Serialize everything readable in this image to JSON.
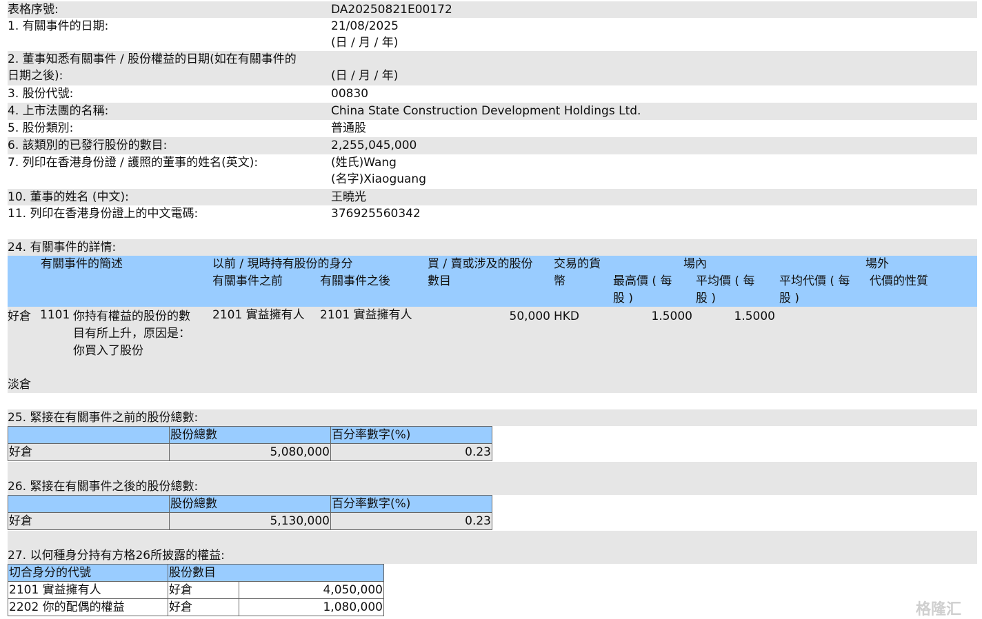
{
  "form": {
    "serial_label": "表格序號:",
    "serial": "DA20250821E00172",
    "f1_label": "1. 有關事件的日期:",
    "f1_value": "21/08/2025",
    "date_fmt": "(日 / 月 / 年)",
    "f2_label_l1": "2. 董事知悉有關事件 / 股份權益的日期(如在有關事件的",
    "f2_label_l2": "日期之後):",
    "f2_value": "(日 / 月 / 年)",
    "f3_label": "3. 股份代號:",
    "f3_value": "00830",
    "f4_label": "4. 上市法團的名稱:",
    "f4_value": "China State Construction Development Holdings Ltd.",
    "f5_label": "5. 股份類別:",
    "f5_value": "普通股",
    "f6_label": "6. 該類別的已發行股份的數目:",
    "f6_value": "2,255,045,000",
    "f7_label": "7. 列印在香港身份證 / 護照的董事的姓名(英文):",
    "f7_surname": "(姓氏)Wang",
    "f7_given": "(名字)Xiaoguang",
    "f10_label": "10. 董事的姓名 (中文):",
    "f10_value": "王曉光",
    "f11_label": "11. 列印在香港身份證上的中文電碼:",
    "f11_value": "376925560342"
  },
  "s24": {
    "title": "24. 有關事件的詳情:",
    "h_desc": "有關事件的簡述",
    "h_capacity": "以前 / 現時持有股份的身分",
    "h_before": "有關事件之前",
    "h_after": "有關事件之後",
    "h_shares_l1": "買 / 賣或涉及的股份",
    "h_shares_l2": "數目",
    "h_currency_l1": "交易的貨",
    "h_currency_l2": "幣",
    "h_onexch": "場內",
    "h_high_l1": "最高價 ( 每",
    "h_high_l2": "股 )",
    "h_avg_l1": "平均價 ( 每",
    "h_avg_l2": "股 )",
    "h_offexch": "場外",
    "h_avgcons_l1": "平均代價 ( 每",
    "h_avgcons_l2": "股 )",
    "h_nature": "代價的性質",
    "row_long": "好倉",
    "row_code": "1101",
    "row_desc_l1": "你持有權益的股份的數",
    "row_desc_l2": "目有所上升，原因是：",
    "row_desc_l3": "你買入了股份",
    "row_before": "2101 實益擁有人",
    "row_after": "2101 實益擁有人",
    "row_shares": "50,000",
    "row_currency": "HKD",
    "row_high": "1.5000",
    "row_avg": "1.5000",
    "row_short": "淡倉"
  },
  "s25": {
    "title": "25. 緊接在有關事件之前的股份總數:",
    "h_total": "股份總數",
    "h_pct": "百分率數字(%)",
    "row_label": "好倉",
    "total": "5,080,000",
    "pct": "0.23"
  },
  "s26": {
    "title": "26. 緊接在有關事件之後的股份總數:",
    "h_total": "股份總數",
    "h_pct": "百分率數字(%)",
    "row_label": "好倉",
    "total": "5,130,000",
    "pct": "0.23"
  },
  "s27": {
    "title": "27. 以何種身分持有方格26所披露的權益:",
    "h_code": "切合身分的代號",
    "h_shares": "股份數目",
    "rows": [
      {
        "code": "2101 實益擁有人",
        "pos": "好倉",
        "shares": "4,050,000"
      },
      {
        "code": "2202 你的配偶的權益",
        "pos": "好倉",
        "shares": "1,080,000"
      }
    ]
  },
  "watermark": "格隆汇"
}
